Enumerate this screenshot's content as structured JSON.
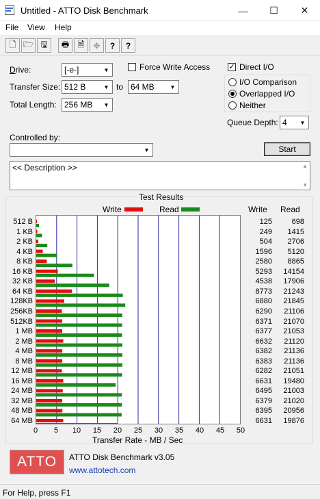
{
  "window": {
    "title": "Untitled - ATTO Disk Benchmark",
    "minimize_glyph": "—",
    "maximize_glyph": "☐",
    "close_glyph": "✕"
  },
  "menu": [
    "File",
    "View",
    "Help"
  ],
  "toolbar": {
    "icons": [
      "new-file-icon",
      "open-folder-icon",
      "save-icon",
      "print-icon",
      "print-preview-icon",
      "move-icon",
      "help-icon",
      "context-help-icon"
    ],
    "glyphs": [
      "🗋",
      "🗁",
      "🖫",
      "🖶",
      "🗎",
      "✥",
      "?",
      "?"
    ]
  },
  "settings": {
    "drive_label": "Drive:",
    "drive_value": "[-e-]",
    "transfer_size_label": "Transfer Size:",
    "transfer_from": "512 B",
    "to_label": "to",
    "transfer_to": "64 MB",
    "total_length_label": "Total Length:",
    "total_length_value": "256 MB",
    "force_write_access": "Force Write Access",
    "direct_io": "Direct I/O",
    "io_comparison": "I/O Comparison",
    "overlapped_io": "Overlapped I/O",
    "neither": "Neither",
    "queue_depth_label": "Queue Depth:",
    "queue_depth_value": "4",
    "controlled_by_label": "Controlled by:",
    "controlled_by_value": "",
    "start_button": "Start",
    "description": "<< Description >>",
    "direct_io_checked": true,
    "force_write_checked": false,
    "selected_mode": "overlapped_io"
  },
  "results": {
    "group_title": "Test Results",
    "legend_write": "Write",
    "legend_read": "Read",
    "col_write": "Write",
    "col_read": "Read",
    "xlabel": "Transfer Rate - MB / Sec",
    "write_color": "#e01010",
    "read_color": "#1a8a1a"
  },
  "chart_data": {
    "type": "bar",
    "orientation": "horizontal",
    "categories": [
      "512 B",
      "1 KB",
      "2 KB",
      "4 KB",
      "8 KB",
      "16 KB",
      "32 KB",
      "64 KB",
      "128KB",
      "256KB",
      "512KB",
      "1 MB",
      "2 MB",
      "4 MB",
      "8 MB",
      "12 MB",
      "16 MB",
      "24 MB",
      "32 MB",
      "48 MB",
      "64 MB"
    ],
    "series": [
      {
        "name": "Write",
        "values": [
          125,
          249,
          504,
          1596,
          2580,
          5293,
          4538,
          8773,
          6880,
          6290,
          6371,
          6377,
          6632,
          6382,
          6383,
          6282,
          6631,
          6495,
          6379,
          6395,
          6631
        ]
      },
      {
        "name": "Read",
        "values": [
          698,
          1415,
          2706,
          5120,
          8865,
          14154,
          17906,
          21243,
          21845,
          21106,
          21070,
          21053,
          21120,
          21136,
          21136,
          21051,
          19480,
          21003,
          21020,
          20956,
          19876
        ]
      }
    ],
    "x_ticks": [
      "0",
      "5",
      "10",
      "15",
      "20",
      "25",
      "30",
      "35",
      "40",
      "45",
      "50"
    ],
    "xlim": [
      0,
      50
    ],
    "xlabel": "Transfer Rate - MB / Sec",
    "grid": true,
    "legend": "top"
  },
  "footer": {
    "logo_text": "ATTO",
    "product": "ATTO Disk Benchmark v3.05",
    "website": "www.attotech.com"
  },
  "status": "For Help, press F1"
}
